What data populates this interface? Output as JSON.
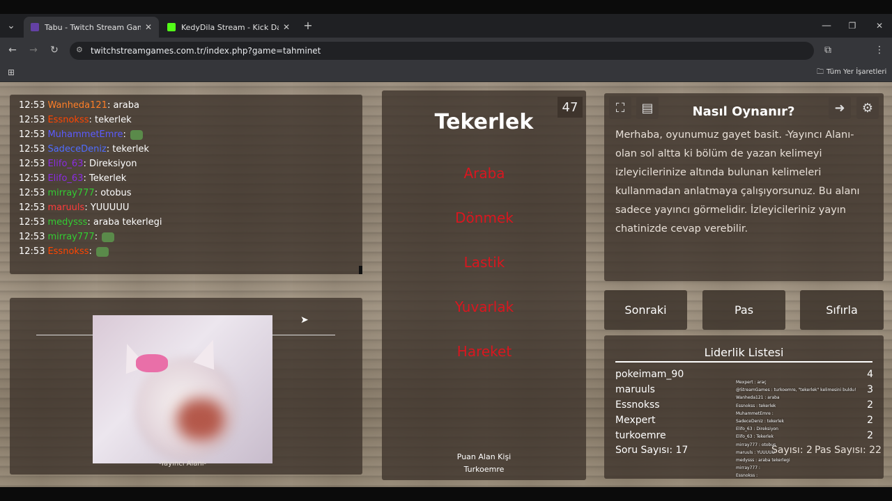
{
  "browser": {
    "tabs": [
      {
        "label": "Tabu - Twitch Stream Games",
        "active": true
      },
      {
        "label": "KedyDila Stream - Kick Dashboard",
        "active": false
      }
    ],
    "new_tab": "+",
    "url": "twitchstreamgames.com.tr/index.php?game=tahminet",
    "bookmarks_label": "Tüm Yer İşaretleri",
    "window_controls": {
      "minimize": "—",
      "restore": "❐",
      "close": "✕"
    }
  },
  "chat": {
    "lines": [
      {
        "time": "12:53",
        "user": "Wanheda121",
        "color": "#ff7f27",
        "message": "araba"
      },
      {
        "time": "12:53",
        "user": "Essnokss",
        "color": "#ff4500",
        "message": "tekerlek"
      },
      {
        "time": "12:53",
        "user": "MuhammetEmre",
        "color": "#5b5bff",
        "message": ""
      },
      {
        "time": "12:53",
        "user": "SadeceDeniz",
        "color": "#4f6cff",
        "message": "tekerlek"
      },
      {
        "time": "12:53",
        "user": "Elifo_63",
        "color": "#8a2be2",
        "message": "Direksiyon"
      },
      {
        "time": "12:53",
        "user": "Elifo_63",
        "color": "#8a2be2",
        "message": "Tekerlek"
      },
      {
        "time": "12:53",
        "user": "mirray777",
        "color": "#32cd32",
        "message": "otobus"
      },
      {
        "time": "12:53",
        "user": "maruuls",
        "color": "#ff3b3b",
        "message": "YUUUUU"
      },
      {
        "time": "12:53",
        "user": "medysss",
        "color": "#32cd32",
        "message": "araba tekerlegi"
      },
      {
        "time": "12:53",
        "user": "mirray777",
        "color": "#32cd32",
        "message": ""
      },
      {
        "time": "12:53",
        "user": "Essnokss",
        "color": "#ff4500",
        "message": ""
      }
    ]
  },
  "streamer": {
    "caption": "-Yayıncı Alanı-"
  },
  "game": {
    "timer": "47",
    "main_word": "Tekerlek",
    "forbidden_words": [
      "Araba",
      "Dönmek",
      "Lastik",
      "Yuvarlak",
      "Hareket"
    ],
    "scorer_label": "Puan Alan Kişi",
    "scorer_name": "Turkoemre"
  },
  "howto": {
    "title": "Nasıl Oynanır?",
    "text": "Merhaba, oyunumuz gayet basit. -Yayıncı Alanı- olan sol altta ki bölüm de yazan kelimeyi izleyicilerinize altında bulunan kelimeleri kullanmadan anlatmaya çalışıyorsunuz. Bu alanı sadece yayıncı görmelidir. İzleyicileriniz yayın chatinizde cevap verebilir."
  },
  "buttons": {
    "next": "Sonraki",
    "pass": "Pas",
    "reset": "Sıfırla"
  },
  "leaderboard": {
    "title": "Liderlik Listesi",
    "rows": [
      {
        "name": "pokeimam_90",
        "score": "4"
      },
      {
        "name": "maruuls",
        "score": "3"
      },
      {
        "name": "Essnokss",
        "score": "2"
      },
      {
        "name": "Mexpert",
        "score": "2"
      },
      {
        "name": "turkoemre",
        "score": "2"
      }
    ],
    "question_count": "Soru Sayısı: 17",
    "correct_count": "Sayısı: 2",
    "pass_count": "Pas Sayısı: 22"
  },
  "overlay_chat": {
    "lines": [
      "Mexpert : araç",
      "@StreamGames : turkoemre, \"tekerlek\" kelimesini buldu!",
      "Wanheda121 : araba",
      "Essnokss : tekerlek",
      "MuhammetEmre :",
      "SadeceDeniz : tekerlek",
      "Elifo_63 : Direksiyon",
      "Elifo_63 : Tekerlek",
      "mirray777 : otobus",
      "maruuls : YUUUUU",
      "medysss : araba tekerlegi",
      "mirray777 :",
      "Essnokss :"
    ]
  }
}
